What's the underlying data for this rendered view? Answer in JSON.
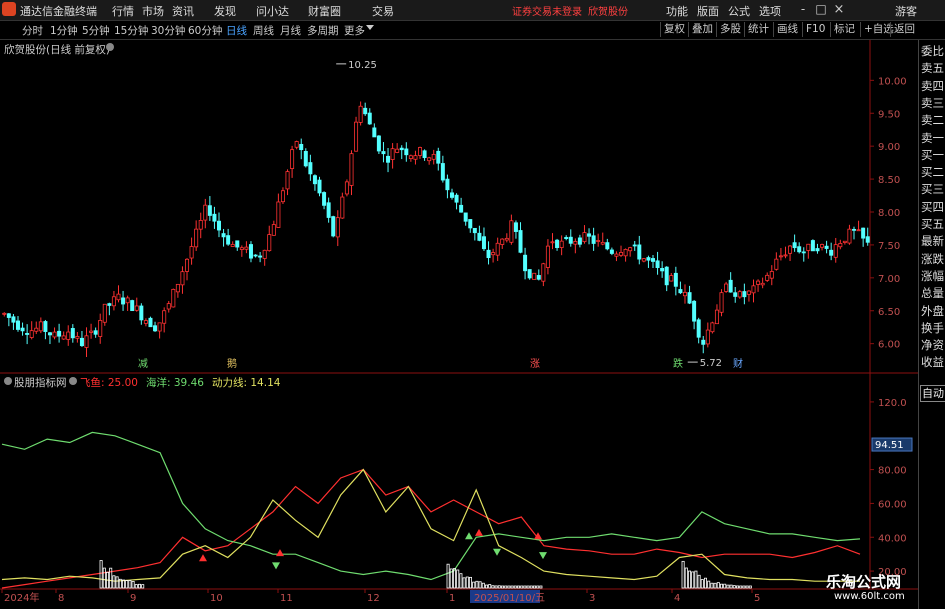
{
  "title_bar": {
    "app_title": "通达信金融终端",
    "menus": [
      "行情",
      "市场",
      "资讯",
      "发现",
      "问小达",
      "财富圈",
      "交易"
    ],
    "login_status": "证券交易未登录",
    "stock_name": "欣贺股份",
    "right_menus": [
      "功能",
      "版面",
      "公式",
      "选项"
    ],
    "guest": "游客",
    "window_buttons": [
      "-",
      "□",
      "×"
    ]
  },
  "toolbar": {
    "periods": [
      "分时",
      "1分钟",
      "5分钟",
      "15分钟",
      "30分钟",
      "60分钟",
      "日线",
      "周线",
      "月线",
      "多周期",
      "更多"
    ],
    "active_period": "日线",
    "buttons": [
      "复权",
      "叠加",
      "多股",
      "统计",
      "画线",
      "F10",
      "标记",
      "+自选",
      "返回"
    ]
  },
  "side_panel": {
    "items": [
      "委比",
      "卖五",
      "卖四",
      "卖三",
      "卖二",
      "卖一",
      "买一",
      "买二",
      "买三",
      "买四",
      "买五",
      "最新",
      "涨跌",
      "涨幅",
      "总量",
      "外盘",
      "换手",
      "净资",
      "收益"
    ],
    "auto_button": "自动"
  },
  "price_chart": {
    "label": "欣贺股份(日线 前复权)",
    "y_ticks": [
      "10.00",
      "9.50",
      "9.00",
      "8.50",
      "8.00",
      "7.50",
      "7.00",
      "6.50",
      "6.00"
    ],
    "high_label": "10.25",
    "low_label": "5.72",
    "markers": [
      {
        "text": "减",
        "color": "#6fdc6f"
      },
      {
        "text": "鹅",
        "color": "#e0c060"
      },
      {
        "text": "涨",
        "color": "#ff5050"
      },
      {
        "text": "跌",
        "color": "#6fdc6f"
      },
      {
        "text": "财",
        "color": "#6aa8ff"
      }
    ]
  },
  "indicator": {
    "label": "股朋指标网",
    "values": [
      {
        "name": "飞鱼",
        "value": "25.00",
        "color": "#ff3030"
      },
      {
        "name": "海洋",
        "value": "39.46",
        "color": "#6fdc6f"
      },
      {
        "name": "动力线",
        "value": "14.14",
        "color": "#e0e060"
      }
    ],
    "y_ticks": [
      "120.0",
      "80.00",
      "60.00",
      "40.00",
      "20.00"
    ],
    "current_value": "94.51"
  },
  "date_axis": {
    "labels": [
      "2024年",
      "8",
      "9",
      "10",
      "11",
      "12",
      "1",
      "2025/01/10/五",
      "3",
      "4",
      "5"
    ]
  },
  "watermark": {
    "text": "乐淘公式网",
    "url": "www.60lt.com"
  },
  "chart_data": [
    {
      "type": "candlestick",
      "title": "欣贺股份(日线 前复权)",
      "ylim": [
        5.6,
        10.4
      ],
      "high": 10.25,
      "low": 5.72,
      "close_path": [
        6.45,
        6.3,
        6.2,
        6.25,
        6.1,
        6.2,
        6.0,
        6.15,
        6.55,
        6.7,
        6.6,
        6.4,
        6.25,
        6.6,
        7.1,
        7.6,
        8.1,
        7.7,
        7.5,
        7.4,
        7.3,
        7.7,
        8.4,
        9.1,
        8.6,
        8.2,
        7.6,
        8.5,
        9.7,
        9.2,
        8.8,
        9.0,
        8.9,
        8.9,
        8.8,
        8.3,
        8.0,
        7.7,
        7.3,
        7.5,
        7.8,
        7.2,
        6.9,
        7.6,
        7.5,
        7.6,
        7.6,
        7.5,
        7.4,
        7.5,
        7.35,
        7.2,
        7.0,
        6.9,
        6.6,
        6.0,
        6.5,
        6.9,
        6.7,
        6.8,
        7.0,
        7.3,
        7.5,
        7.4,
        7.5,
        7.4,
        7.6,
        7.7,
        7.5
      ]
    },
    {
      "type": "line",
      "title": "股朋指标网",
      "ylim": [
        10,
        130
      ],
      "series": [
        {
          "name": "飞鱼",
          "color": "#ff3030",
          "values": [
            10,
            12,
            14,
            16,
            18,
            20,
            22,
            25,
            40,
            32,
            35,
            45,
            55,
            70,
            60,
            75,
            80,
            65,
            70,
            55,
            62,
            55,
            48,
            52,
            35,
            33,
            32,
            30,
            30,
            33,
            31,
            28,
            30,
            30,
            30,
            28,
            31,
            35,
            30
          ]
        },
        {
          "name": "海洋",
          "color": "#6fdc6f",
          "values": [
            95,
            92,
            98,
            96,
            102,
            100,
            95,
            90,
            60,
            45,
            38,
            35,
            30,
            30,
            25,
            20,
            18,
            20,
            18,
            15,
            20,
            40,
            42,
            40,
            38,
            40,
            40,
            42,
            40,
            38,
            40,
            55,
            48,
            45,
            42,
            42,
            40,
            38,
            39
          ]
        },
        {
          "name": "动力线",
          "color": "#e0e060",
          "values": [
            15,
            16,
            15,
            17,
            16,
            14,
            15,
            16,
            30,
            35,
            28,
            40,
            62,
            50,
            40,
            65,
            80,
            55,
            70,
            45,
            38,
            68,
            35,
            28,
            20,
            18,
            17,
            16,
            15,
            17,
            28,
            30,
            18,
            16,
            15,
            15,
            14,
            14,
            14
          ]
        }
      ]
    }
  ]
}
